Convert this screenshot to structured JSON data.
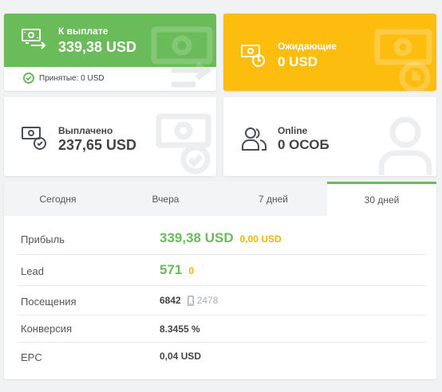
{
  "cards": {
    "payout": {
      "label": "К выплате",
      "value": "339,38 USD",
      "accepted": "Принятые: 0 USD"
    },
    "pending": {
      "label": "Ожидающие",
      "value": "0 USD"
    },
    "paid": {
      "label": "Выплачено",
      "value": "237,65 USD"
    },
    "online": {
      "label": "Online",
      "value": "0 ОСОБ"
    }
  },
  "tabs": [
    {
      "label": "Сегодня"
    },
    {
      "label": "Вчера"
    },
    {
      "label": "7 дней"
    },
    {
      "label": "30 дней"
    }
  ],
  "active_tab": "30 дней",
  "stats": {
    "profit": {
      "label": "Прибыль",
      "value": "339,38 USD",
      "secondary": "0,00 USD"
    },
    "lead": {
      "label": "Lead",
      "value": "571",
      "secondary": "0"
    },
    "visits": {
      "label": "Посещения",
      "value": "6842",
      "mobile": "2478"
    },
    "conversion": {
      "label": "Конверсия",
      "value": "8.3455 %"
    },
    "epc": {
      "label": "EPC",
      "value": "0,04 USD"
    }
  },
  "colors": {
    "green": "#6abb5a",
    "yellow": "#fdbd0f",
    "text": "#444444"
  }
}
